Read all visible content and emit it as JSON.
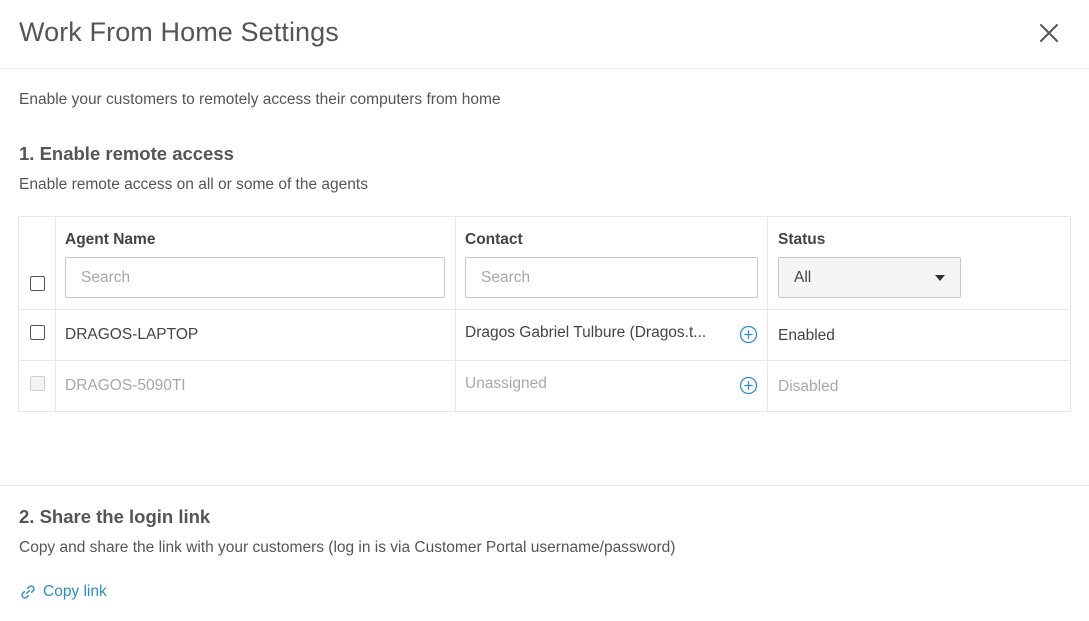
{
  "dialog": {
    "title": "Work From Home Settings",
    "intro": "Enable your customers to remotely access their computers from home"
  },
  "section1": {
    "title": "1. Enable remote access",
    "description": "Enable remote access on all or some of the agents"
  },
  "table": {
    "columns": {
      "agent_name": "Agent Name",
      "contact": "Contact",
      "status": "Status"
    },
    "filters": {
      "agent_name_placeholder": "Search",
      "contact_placeholder": "Search",
      "status_selected": "All"
    },
    "rows": [
      {
        "agent": "DRAGOS-LAPTOP",
        "contact": "Dragos Gabriel Tulbure (Dragos.t...",
        "status": "Enabled",
        "selectable": true
      },
      {
        "agent": "DRAGOS-5090TI",
        "contact": "Unassigned",
        "status": "Disabled",
        "selectable": false
      }
    ]
  },
  "section2": {
    "title": "2. Share the login link",
    "description": "Copy and share the link with your customers (log in is via Customer Portal username/password)",
    "copy_link_label": "Copy link"
  },
  "colors": {
    "accent": "#2a8fc9",
    "text": "#444444",
    "muted": "#a8a8a8",
    "border": "#e6e6e6"
  },
  "icons": {
    "close": "close-icon",
    "assign_contact": "plus-circle-icon",
    "copy_link": "link-icon",
    "select_caret": "caret-down-icon"
  }
}
